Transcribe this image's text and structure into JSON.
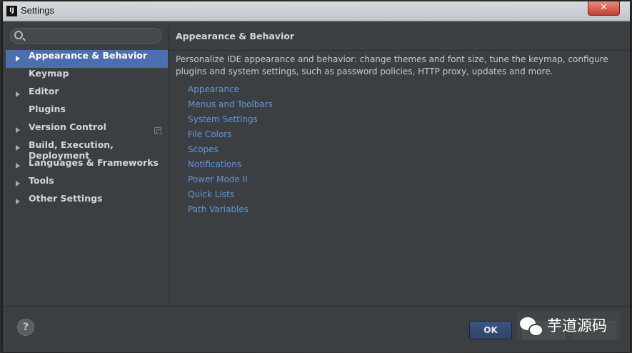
{
  "window": {
    "title": "Settings",
    "app_icon": "IJ",
    "close_glyph": "✕"
  },
  "search": {
    "placeholder": ""
  },
  "sidebar": {
    "items": [
      {
        "label": "Appearance & Behavior",
        "expandable": true,
        "selected": true
      },
      {
        "label": "Keymap",
        "expandable": false
      },
      {
        "label": "Editor",
        "expandable": true
      },
      {
        "label": "Plugins",
        "expandable": false
      },
      {
        "label": "Version Control",
        "expandable": true,
        "copy_icon": true
      },
      {
        "label": "Build, Execution, Deployment",
        "expandable": true
      },
      {
        "label": "Languages & Frameworks",
        "expandable": true
      },
      {
        "label": "Tools",
        "expandable": true
      },
      {
        "label": "Other Settings",
        "expandable": true
      }
    ]
  },
  "main": {
    "title": "Appearance & Behavior",
    "description": "Personalize IDE appearance and behavior: change themes and font size, tune the keymap, configure plugins and system settings, such as password policies, HTTP proxy, updates and more.",
    "links": [
      "Appearance",
      "Menus and Toolbars",
      "System Settings",
      "File Colors",
      "Scopes",
      "Notifications",
      "Power Mode II",
      "Quick Lists",
      "Path Variables"
    ]
  },
  "footer": {
    "help_glyph": "?",
    "ok_label": "OK"
  },
  "watermark": {
    "text": "芋道源码"
  },
  "colors": {
    "selection": "#4b6eaf",
    "link": "#5f98d8",
    "background": "#3c3f41"
  }
}
